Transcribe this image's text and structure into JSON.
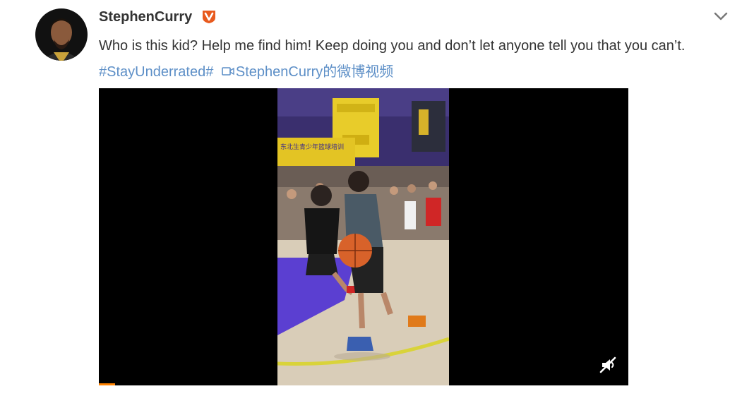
{
  "post": {
    "author": "StephenCurry",
    "verified_badge": "verified-v-icon",
    "text": "Who is this kid? Help me find him! Keep doing you and don’t let anyone tell you that you can’t.",
    "hashtag": "#StayUnderrated#",
    "video_link": "StephenCurry的微博视频",
    "video_link_icon": "camera-icon",
    "menu_icon": "chevron-down-icon"
  },
  "video": {
    "banner_text": "东北生青少年篮球培训",
    "mute_icon": "muted-speaker-icon",
    "progress_fraction": 0.03,
    "progress_color": "#ff8200"
  },
  "colors": {
    "link": "#5d8fc7",
    "text": "#333333",
    "badge": "#e85a1e"
  }
}
